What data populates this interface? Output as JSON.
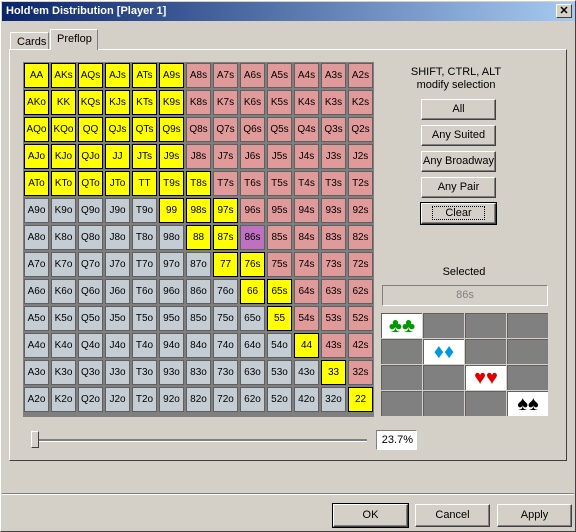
{
  "window": {
    "title": "Hold'em Distribution [Player 1]",
    "close_glyph": "✕"
  },
  "tabs": [
    {
      "label": "Cards"
    },
    {
      "label": "Preflop"
    }
  ],
  "hand_grid": {
    "rows": [
      [
        "AA",
        "AKs",
        "AQs",
        "AJs",
        "ATs",
        "A9s",
        "A8s",
        "A7s",
        "A6s",
        "A5s",
        "A4s",
        "A3s",
        "A2s"
      ],
      [
        "AKo",
        "KK",
        "KQs",
        "KJs",
        "KTs",
        "K9s",
        "K8s",
        "K7s",
        "K6s",
        "K5s",
        "K4s",
        "K3s",
        "K2s"
      ],
      [
        "AQo",
        "KQo",
        "QQ",
        "QJs",
        "QTs",
        "Q9s",
        "Q8s",
        "Q7s",
        "Q6s",
        "Q5s",
        "Q4s",
        "Q3s",
        "Q2s"
      ],
      [
        "AJo",
        "KJo",
        "QJo",
        "JJ",
        "JTs",
        "J9s",
        "J8s",
        "J7s",
        "J6s",
        "J5s",
        "J4s",
        "J3s",
        "J2s"
      ],
      [
        "ATo",
        "KTo",
        "QTo",
        "JTo",
        "TT",
        "T9s",
        "T8s",
        "T7s",
        "T6s",
        "T5s",
        "T4s",
        "T3s",
        "T2s"
      ],
      [
        "A9o",
        "K9o",
        "Q9o",
        "J9o",
        "T9o",
        "99",
        "98s",
        "97s",
        "96s",
        "95s",
        "94s",
        "93s",
        "92s"
      ],
      [
        "A8o",
        "K8o",
        "Q8o",
        "J8o",
        "T8o",
        "98o",
        "88",
        "87s",
        "86s",
        "85s",
        "84s",
        "83s",
        "82s"
      ],
      [
        "A7o",
        "K7o",
        "Q7o",
        "J7o",
        "T7o",
        "97o",
        "87o",
        "77",
        "76s",
        "75s",
        "74s",
        "73s",
        "72s"
      ],
      [
        "A6o",
        "K6o",
        "Q6o",
        "J6o",
        "T6o",
        "96o",
        "86o",
        "76o",
        "66",
        "65s",
        "64s",
        "63s",
        "62s"
      ],
      [
        "A5o",
        "K5o",
        "Q5o",
        "J5o",
        "T5o",
        "95o",
        "85o",
        "75o",
        "65o",
        "55",
        "54s",
        "53s",
        "52s"
      ],
      [
        "A4o",
        "K4o",
        "Q4o",
        "J4o",
        "T4o",
        "94o",
        "84o",
        "74o",
        "64o",
        "54o",
        "44",
        "43s",
        "42s"
      ],
      [
        "A3o",
        "K3o",
        "Q3o",
        "J3o",
        "T3o",
        "93o",
        "83o",
        "73o",
        "63o",
        "53o",
        "43o",
        "33",
        "32s"
      ],
      [
        "A2o",
        "K2o",
        "Q2o",
        "J2o",
        "T2o",
        "92o",
        "82o",
        "72o",
        "62o",
        "52o",
        "42o",
        "32o",
        "22"
      ]
    ],
    "selected": [
      "AA",
      "AKs",
      "AQs",
      "AJs",
      "ATs",
      "A9s",
      "AKo",
      "KK",
      "KQs",
      "KJs",
      "KTs",
      "K9s",
      "AQo",
      "KQo",
      "QQ",
      "QJs",
      "QTs",
      "Q9s",
      "AJo",
      "KJo",
      "QJo",
      "JJ",
      "JTs",
      "J9s",
      "ATo",
      "KTo",
      "QTo",
      "JTo",
      "TT",
      "T9s",
      "T8s",
      "99",
      "98s",
      "97s",
      "88",
      "87s",
      "77",
      "76s",
      "66",
      "65s",
      "55",
      "44",
      "33",
      "22"
    ],
    "current": "86s",
    "colors": {
      "selected": "#ffff00",
      "suited": "#e09a9a",
      "offsuit": "#c4cdd4",
      "current": "#c070c0"
    }
  },
  "modifier_hint": "SHIFT, CTRL, ALT modify selection",
  "buttons": {
    "all": "All",
    "any_suited": "Any Suited",
    "any_broadway": "Any Broadway",
    "any_pair": "Any Pair",
    "clear": "Clear"
  },
  "selected_panel": {
    "label": "Selected",
    "value": "86s"
  },
  "suit_matrix": {
    "suits": [
      {
        "name": "clubs",
        "glyph": "♣♣",
        "color": "green"
      },
      {
        "name": "diamonds",
        "glyph": "♦♦",
        "color": "blue"
      },
      {
        "name": "hearts",
        "glyph": "♥♥",
        "color": "red"
      },
      {
        "name": "spades",
        "glyph": "♠♠",
        "color": "black"
      }
    ]
  },
  "range_slider": {
    "value_fraction": 0.0,
    "percent_label": "23.7%"
  },
  "footer": {
    "ok": "OK",
    "cancel": "Cancel",
    "apply": "Apply"
  }
}
